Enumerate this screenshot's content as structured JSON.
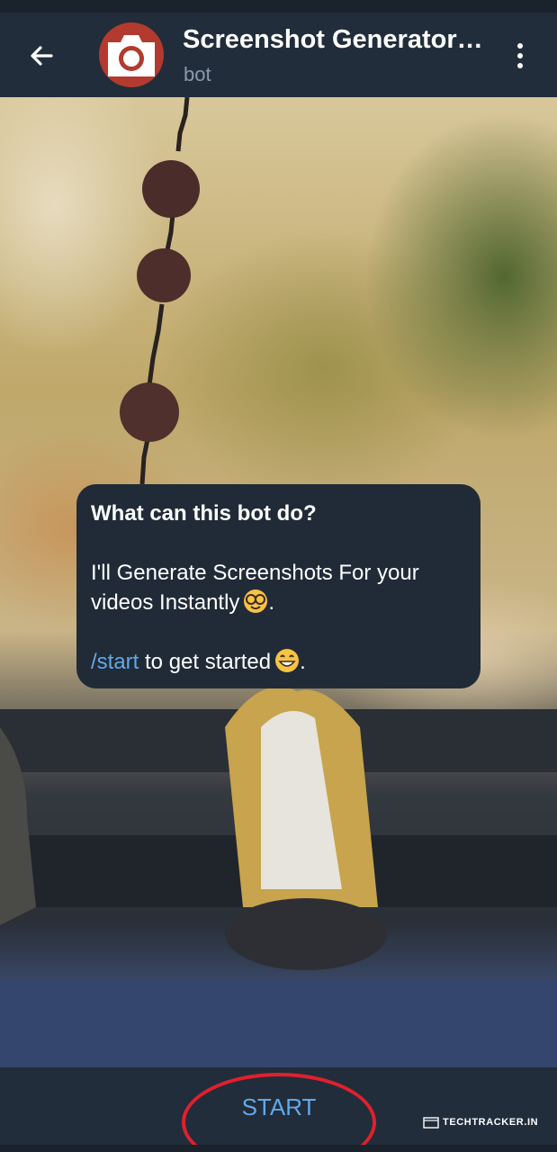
{
  "header": {
    "title": "Screenshot Generator…",
    "subtitle": "bot",
    "back_icon": "arrow-left-icon",
    "menu_icon": "more-vertical-icon",
    "avatar_icon": "camera-icon",
    "avatar_color": "#b23a2e"
  },
  "bot_info": {
    "title": "What can this bot do?",
    "line1": "I'll Generate Screenshots For your videos Instantly",
    "line1_end": ".",
    "command": "/start",
    "command_rest": " to get started",
    "command_end": ".",
    "emoji1": "nerd-face-emoji",
    "emoji2": "grinning-face-emoji"
  },
  "bottom": {
    "start_label": "START"
  },
  "watermark": {
    "text": "TECHTRACKER.IN"
  },
  "colors": {
    "header_bg": "#212d3b",
    "bubble_bg": "#202b37",
    "accent": "#62a8e8",
    "highlight": "#e1202c"
  }
}
